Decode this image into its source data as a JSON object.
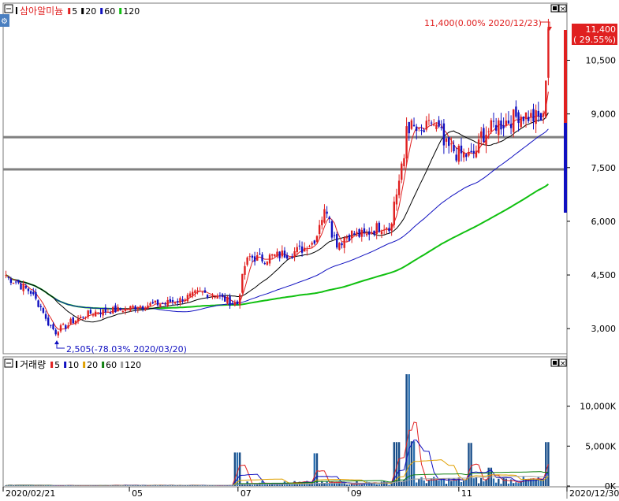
{
  "price_panel": {
    "legend": {
      "name": "삼아알미늄",
      "ma": [
        {
          "label": "5",
          "color": "#e02020"
        },
        {
          "label": "20",
          "color": "#000000"
        },
        {
          "label": "60",
          "color": "#1010c0"
        },
        {
          "label": "120",
          "color": "#10c010"
        }
      ]
    },
    "y_ticks": [
      "10,500",
      "9,000",
      "7,500",
      "6,000",
      "4,500",
      "3,000"
    ],
    "current_badge": {
      "price": "11,400",
      "change": "( 29.55%)"
    },
    "annotation_high": "11,400(0.00% 2020/12/23)",
    "annotation_low": "2,505(-78.03% 2020/03/20)",
    "horizontal_lines": [
      8350,
      7450
    ]
  },
  "volume_panel": {
    "legend": {
      "name": "거래량",
      "ma": [
        {
          "label": "5",
          "color": "#e02020"
        },
        {
          "label": "10",
          "color": "#1010c0"
        },
        {
          "label": "20",
          "color": "#e0a000"
        },
        {
          "label": "60",
          "color": "#108010"
        },
        {
          "label": "120",
          "color": "#a0a0a0"
        }
      ]
    },
    "y_ticks": [
      "10,000K",
      "5,000K",
      "0K"
    ]
  },
  "x_axis": {
    "ticks": [
      "2020/02/21",
      "05",
      "07",
      "09",
      "11",
      "2020/12/30"
    ]
  },
  "colors": {
    "up": "#e02020",
    "down": "#1010c0",
    "gridline": "#808080"
  },
  "chart_data": {
    "type": "candlestick",
    "price_axis": {
      "ylim": [
        2300,
        11700
      ],
      "ticks": [
        3000,
        4500,
        6000,
        7500,
        9000,
        10500
      ]
    },
    "volume_axis": {
      "ylim": [
        0,
        14500000
      ],
      "ticks": [
        0,
        5000000,
        10000000
      ]
    },
    "series_close": [
      [
        "2020-02-21",
        4500
      ],
      [
        "2020-03-02",
        4200
      ],
      [
        "2020-03-09",
        3900
      ],
      [
        "2020-03-13",
        3500
      ],
      [
        "2020-03-20",
        2900
      ],
      [
        "2020-03-27",
        3100
      ],
      [
        "2020-04-03",
        3300
      ],
      [
        "2020-04-10",
        3450
      ],
      [
        "2020-04-20",
        3500
      ],
      [
        "2020-04-29",
        3550
      ],
      [
        "2020-05-08",
        3650
      ],
      [
        "2020-05-20",
        3700
      ],
      [
        "2020-05-29",
        3800
      ],
      [
        "2020-06-10",
        4000
      ],
      [
        "2020-06-19",
        3950
      ],
      [
        "2020-06-26",
        3750
      ],
      [
        "2020-07-01",
        3700
      ],
      [
        "2020-07-03",
        4400
      ],
      [
        "2020-07-08",
        5000
      ],
      [
        "2020-07-15",
        4950
      ],
      [
        "2020-07-24",
        5050
      ],
      [
        "2020-08-03",
        5150
      ],
      [
        "2020-08-12",
        5400
      ],
      [
        "2020-08-20",
        6350
      ],
      [
        "2020-08-26",
        5400
      ],
      [
        "2020-09-03",
        5650
      ],
      [
        "2020-09-11",
        5600
      ],
      [
        "2020-09-18",
        5850
      ],
      [
        "2020-09-25",
        5900
      ],
      [
        "2020-09-29",
        6800
      ],
      [
        "2020-10-05",
        8700
      ],
      [
        "2020-10-12",
        8400
      ],
      [
        "2020-10-19",
        8800
      ],
      [
        "2020-10-26",
        8100
      ],
      [
        "2020-11-02",
        7900
      ],
      [
        "2020-11-10",
        7800
      ],
      [
        "2020-11-16",
        8400
      ],
      [
        "2020-11-23",
        8700
      ],
      [
        "2020-11-30",
        8800
      ],
      [
        "2020-12-07",
        9000
      ],
      [
        "2020-12-14",
        8900
      ],
      [
        "2020-12-21",
        8850
      ],
      [
        "2020-12-23",
        11400
      ]
    ],
    "ma5_label": "5",
    "ma20_label": "20",
    "ma60_label": "60",
    "ma120_label": "120",
    "volume_spikes": [
      [
        "2020-07-01",
        4200000
      ],
      [
        "2020-08-14",
        4100000
      ],
      [
        "2020-09-29",
        5500000
      ],
      [
        "2020-10-05",
        14000000
      ],
      [
        "2020-10-07",
        5600000
      ],
      [
        "2020-11-09",
        5400000
      ],
      [
        "2020-11-20",
        2300000
      ],
      [
        "2020-12-23",
        5500000
      ]
    ],
    "high": {
      "value": 11400,
      "date": "2020/12/23",
      "pct": "0.00%"
    },
    "low": {
      "value": 2505,
      "date": "2020/03/20",
      "pct": "-78.03%"
    }
  }
}
